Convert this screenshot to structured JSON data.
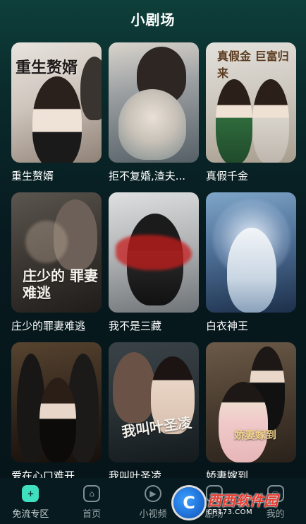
{
  "header": {
    "title": "小剧场"
  },
  "dramas": [
    {
      "title": "重生赘婿",
      "poster_text": "重生赘婿"
    },
    {
      "title": "拒不复婚,渣夫...",
      "poster_text": ""
    },
    {
      "title": "真假千金",
      "poster_text": "真假金 巨富归来"
    },
    {
      "title": "庄少的罪妻难逃",
      "poster_text": "庄少的 罪妻难逃"
    },
    {
      "title": "我不是三藏",
      "poster_text": ""
    },
    {
      "title": "白衣神王",
      "poster_text": ""
    },
    {
      "title": "爱在心口难开",
      "poster_text": ""
    },
    {
      "title": "我叫叶圣凌",
      "poster_text": "我叫叶圣凌"
    },
    {
      "title": "娇妻嫁到",
      "poster_text": "娇妻嫁到"
    }
  ],
  "tabbar": {
    "items": [
      {
        "label": "免流专区",
        "icon": "plus-icon",
        "active": true
      },
      {
        "label": "首页",
        "icon": "home-icon",
        "active": false
      },
      {
        "label": "小视频",
        "icon": "play-icon",
        "active": false
      },
      {
        "label": "剧场",
        "icon": "theater-icon",
        "active": false
      },
      {
        "label": "我的",
        "icon": "profile-icon",
        "active": false
      }
    ]
  },
  "watermark": {
    "logo_letter": "C",
    "main": "西西软件园",
    "sub": "CR173.COM"
  },
  "colors": {
    "accent": "#3ee0c0",
    "background": "#071a1f",
    "watermark_red": "#e83b2f"
  }
}
